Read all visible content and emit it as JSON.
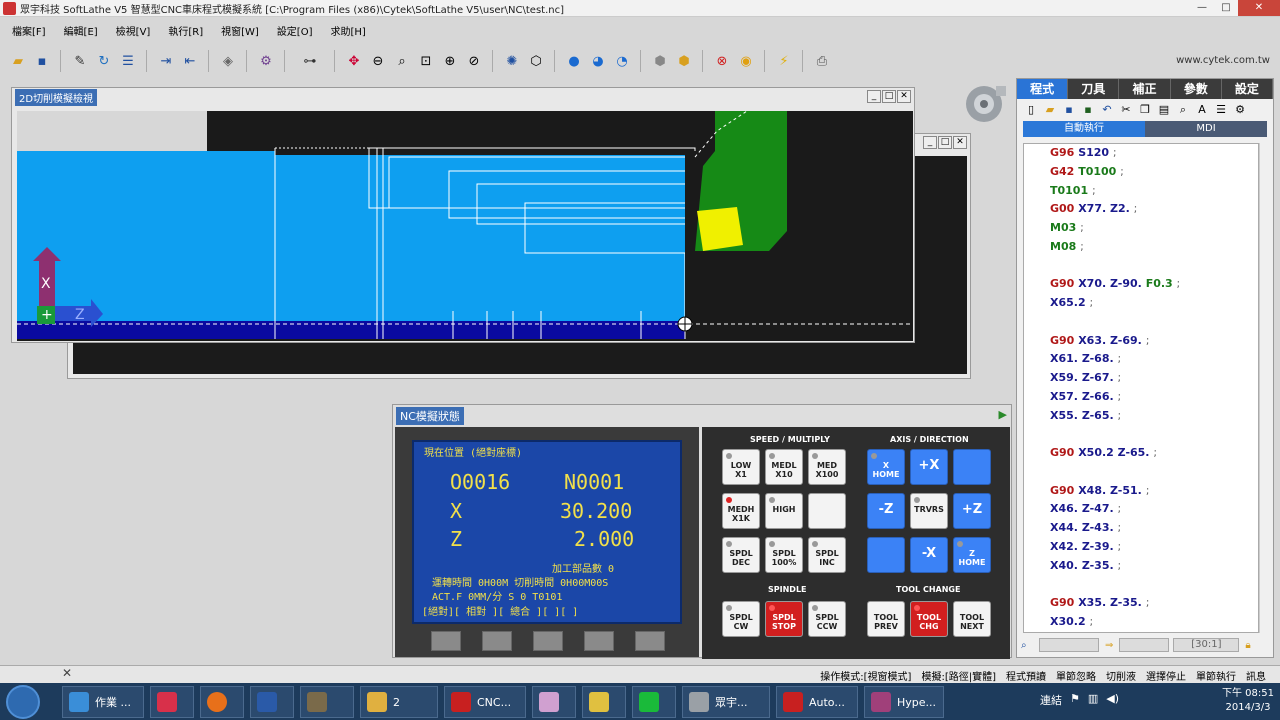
{
  "title": "眾宇科技 SoftLathe V5 智慧型CNC車床程式模擬系統 [C:\\Program Files (x86)\\Cytek\\SoftLathe V5\\user\\NC\\test.nc]",
  "menu": [
    "檔案[F]",
    "編輯[E]",
    "檢視[V]",
    "執行[R]",
    "視窗[W]",
    "設定[O]",
    "求助[H]"
  ],
  "url": "www.cytek.com.tw",
  "win2d": {
    "title": "2D切削模擬檢視",
    "axis_x": "X",
    "axis_z": "Z"
  },
  "right": {
    "tabs": [
      "程式",
      "刀具",
      "補正",
      "參數",
      "設定"
    ],
    "modes": [
      "自動執行",
      "MDI"
    ],
    "status_field": "[30:1]"
  },
  "code": [
    [
      [
        "g",
        "G96"
      ],
      [
        "xz",
        "S120"
      ]
    ],
    [
      [
        "g",
        "G42"
      ],
      [
        "m",
        "T0100"
      ]
    ],
    [
      [
        "m",
        "T0101"
      ]
    ],
    [
      [
        "g",
        "G00"
      ],
      [
        "xz",
        "X77."
      ],
      [
        "xz",
        "Z2."
      ]
    ],
    [
      [
        "m",
        "M03"
      ]
    ],
    [
      [
        "m",
        "M08"
      ]
    ],
    [],
    [
      [
        "g",
        "G90"
      ],
      [
        "xz",
        "X70."
      ],
      [
        "xz",
        "Z-90."
      ],
      [
        "m",
        "F0.3"
      ]
    ],
    [
      [
        "xz",
        "X65.2"
      ]
    ],
    [],
    [
      [
        "g",
        "G90"
      ],
      [
        "xz",
        "X63."
      ],
      [
        "xz",
        "Z-69."
      ]
    ],
    [
      [
        "xz",
        "X61."
      ],
      [
        "xz",
        "Z-68."
      ]
    ],
    [
      [
        "xz",
        "X59."
      ],
      [
        "xz",
        "Z-67."
      ]
    ],
    [
      [
        "xz",
        "X57."
      ],
      [
        "xz",
        "Z-66."
      ]
    ],
    [
      [
        "xz",
        "X55."
      ],
      [
        "xz",
        "Z-65."
      ]
    ],
    [],
    [
      [
        "g",
        "G90"
      ],
      [
        "xz",
        "X50.2"
      ],
      [
        "xz",
        "Z-65."
      ]
    ],
    [],
    [
      [
        "g",
        "G90"
      ],
      [
        "xz",
        "X48."
      ],
      [
        "xz",
        "Z-51."
      ]
    ],
    [
      [
        "xz",
        "X46."
      ],
      [
        "xz",
        "Z-47."
      ]
    ],
    [
      [
        "xz",
        "X44."
      ],
      [
        "xz",
        "Z-43."
      ]
    ],
    [
      [
        "xz",
        "X42."
      ],
      [
        "xz",
        "Z-39."
      ]
    ],
    [
      [
        "xz",
        "X40."
      ],
      [
        "xz",
        "Z-35."
      ]
    ],
    [],
    [
      [
        "g",
        "G90"
      ],
      [
        "xz",
        "X35."
      ],
      [
        "xz",
        "Z-35."
      ]
    ],
    [
      [
        "xz",
        "X30.2"
      ]
    ]
  ],
  "nc": {
    "title": "NC模擬狀態",
    "lcd": {
      "caption": "現在位置 (絕對座標)",
      "prog": "O0016",
      "seq": "N0001",
      "x_label": "X",
      "x_val": "30.200",
      "z_label": "Z",
      "z_val": "2.000",
      "parts": "加工部品數    0",
      "run": "運轉時間   0H00M  切削時間  0H00M00S",
      "actf": "ACT.F     0MM/分  S    0     T0101",
      "menu": "[絕對][ 相對 ][ 總合 ][      ][      ]"
    },
    "sections": {
      "speed": "SPEED / MULTIPLY",
      "axis": "AXIS / DIRECTION",
      "spindle": "SPINDLE",
      "toolchange": "TOOL CHANGE"
    },
    "keys": {
      "low": "LOW\nX1",
      "medl": "MEDL\nX10",
      "med": "MED\nX100",
      "medh": "MEDH\nX1K",
      "high": "HIGH",
      "sdec": "SPDL\nDEC",
      "s100": "SPDL\n100%",
      "sinc": "SPDL\nINC",
      "xhome": "X\nHOME",
      "px": "+X",
      "mz": "-Z",
      "trvrs": "TRVRS",
      "pz": "+Z",
      "mx": "-X",
      "zhome": "Z\nHOME",
      "scw": "SPDL\nCW",
      "sstop": "SPDL\nSTOP",
      "sccw": "SPDL\nCCW",
      "tprev": "TOOL\nPREV",
      "tchg": "TOOL\nCHG",
      "tnext": "TOOL\nNEXT"
    }
  },
  "status": [
    "操作模式:[視窗模式]",
    "模擬:[路徑|實體]",
    "程式預讀",
    "單節忽略",
    "切削液",
    "選擇停止",
    "單節執行",
    "訊息"
  ],
  "taskbar": {
    "items": [
      "作業 ...",
      "2",
      "CNC...",
      "眾宇...",
      "Auto...",
      "Hype..."
    ],
    "lang": "連結",
    "time": "下午 08:51",
    "date": "2014/3/3"
  }
}
